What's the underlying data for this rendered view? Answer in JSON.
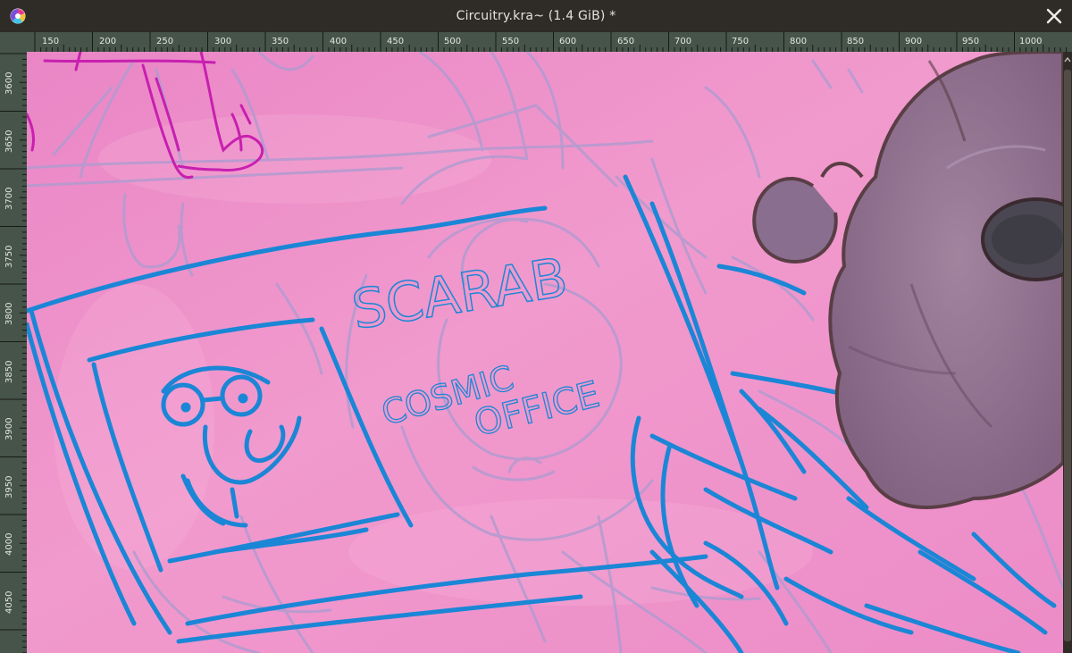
{
  "window": {
    "title": "Circuitry.kra~ (1.4 GiB) *",
    "app_icon": "krita-logo-icon",
    "close_icon": "close-icon"
  },
  "rulers": {
    "horizontal_labels": [
      "150",
      "200",
      "250",
      "300",
      "350",
      "400",
      "450",
      "500",
      "550",
      "600",
      "650",
      "700",
      "750",
      "800",
      "850",
      "900",
      "950",
      "1000"
    ],
    "vertical_labels": [
      "3600",
      "3650",
      "3700",
      "3750",
      "3800",
      "3850",
      "3900",
      "3950",
      "4000",
      "4050"
    ]
  },
  "canvas": {
    "sketch_text": [
      "SCARAB",
      "COSMIC",
      "OFFICE"
    ],
    "colors": {
      "background": "#ee92cc",
      "sketch_blue": "#1b86d6",
      "sketch_lavender": "#b49bcc",
      "sketch_magenta": "#c81fb0",
      "creature_body": "#8f7090",
      "creature_outline": "#5a3e46",
      "ruler_bg": "#46544a"
    }
  }
}
